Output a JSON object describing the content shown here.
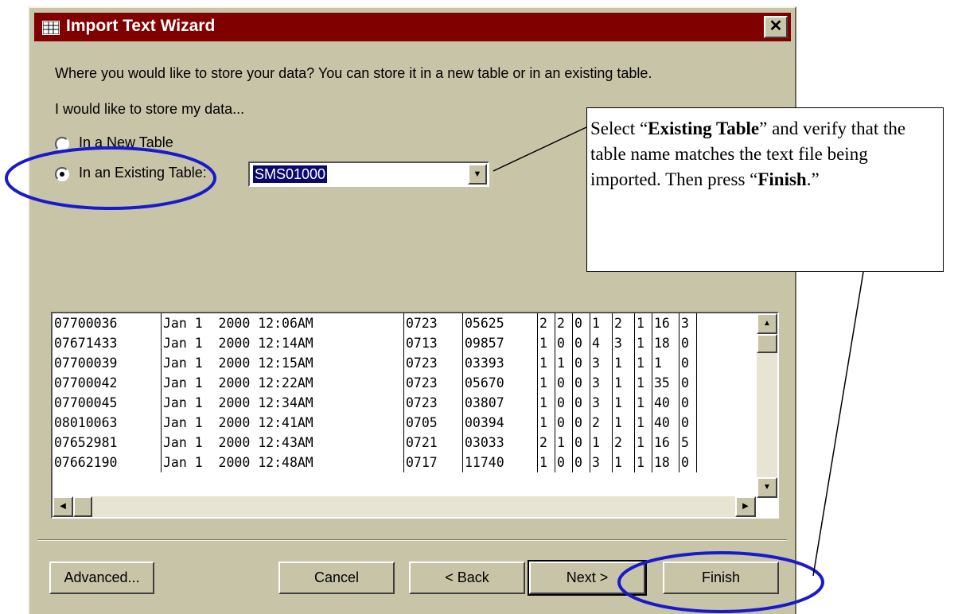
{
  "window": {
    "title": "Import Text Wizard",
    "close_label": "✕"
  },
  "prompt": "Where you would like to store your data?  You can store it in a new table or in an existing table.",
  "store_label": "I would like to store my data...",
  "options": {
    "new_table": {
      "label": "In a New Table",
      "selected": false
    },
    "existing_table": {
      "label": "In an Existing Table:",
      "selected": true
    }
  },
  "table_select": {
    "value": "SMS01000"
  },
  "preview_rows": [
    [
      "07700036",
      "Jan 1  2000 12:06AM",
      "0723",
      "05625",
      "2",
      "2",
      "0",
      "1",
      "2",
      "1",
      "16",
      "3"
    ],
    [
      "07671433",
      "Jan 1  2000 12:14AM",
      "0713",
      "09857",
      "1",
      "0",
      "0",
      "4",
      "3",
      "1",
      "18",
      "0"
    ],
    [
      "07700039",
      "Jan 1  2000 12:15AM",
      "0723",
      "03393",
      "1",
      "1",
      "0",
      "3",
      "1",
      "1",
      "1",
      "0"
    ],
    [
      "07700042",
      "Jan 1  2000 12:22AM",
      "0723",
      "05670",
      "1",
      "0",
      "0",
      "3",
      "1",
      "1",
      "35",
      "0"
    ],
    [
      "07700045",
      "Jan 1  2000 12:34AM",
      "0723",
      "03807",
      "1",
      "0",
      "0",
      "3",
      "1",
      "1",
      "40",
      "0"
    ],
    [
      "08010063",
      "Jan 1  2000 12:41AM",
      "0705",
      "00394",
      "1",
      "0",
      "0",
      "2",
      "1",
      "1",
      "40",
      "0"
    ],
    [
      "07652981",
      "Jan 1  2000 12:43AM",
      "0721",
      "03033",
      "2",
      "1",
      "0",
      "1",
      "2",
      "1",
      "16",
      "5"
    ],
    [
      "07662190",
      "Jan 1  2000 12:48AM",
      "0717",
      "11740",
      "1",
      "0",
      "0",
      "3",
      "1",
      "1",
      "18",
      "0"
    ]
  ],
  "buttons": {
    "advanced": "Advanced...",
    "cancel": "Cancel",
    "back": "< Back",
    "next": "Next >",
    "finish": "Finish"
  },
  "callout": {
    "t1": "Select “",
    "b1": "Existing Table",
    "t2": "” and verify that the table name matches the text file being imported.  Then press “",
    "b2": "Finish",
    "t3": ".”"
  },
  "colors": {
    "titlebar": "#800000",
    "dialog": "#c8c4a8",
    "highlight": "#1a1acd",
    "selection": "#0a0a6e"
  }
}
